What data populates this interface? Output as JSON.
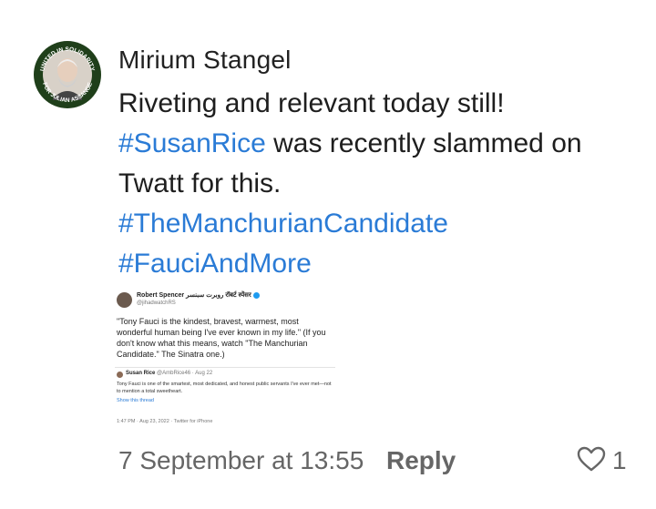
{
  "comment": {
    "author": "Mirium Stangel",
    "body": {
      "part1": "Riveting and relevant today still! ",
      "hashtag1": "#SusanRice",
      "part2": " was recently slammed on Twatt for this.",
      "hashtag2": "#TheManchurianCandidate",
      "hashtag3": "#FauciAndMore"
    },
    "avatar_text": {
      "top": "UNITED IN SOLIDARITY",
      "bottom": "FOR JULIAN ASSANGE"
    },
    "timestamp": "7 September at 13:55",
    "reply_label": "Reply",
    "like_count": "1"
  },
  "embedded_tweet": {
    "author": "Robert Spencer روبرت سبنسر रॉबर्ट स्पेंसर",
    "handle": "@jihadwatchRS",
    "text": "\"Tony Fauci is the kindest, bravest, warmest, most wonderful human being I've ever known in my life.\" (If you don't know what this means, watch \"The Manchurian Candidate.\" The Sinatra one.)",
    "quoted_author": "Susan Rice",
    "quoted_handle_date": "@AmbRice46 · Aug 22",
    "quoted_text": "Tony Fauci is one of the smartest, most dedicated, and honest public servants I've ever met—not to mention a total sweetheart.",
    "show_thread": "Show this thread",
    "meta": "1:47 PM · Aug 23, 2022 · Twitter for iPhone"
  },
  "colors": {
    "hashtag": "#2a7bd6",
    "meta_text": "#666666"
  }
}
